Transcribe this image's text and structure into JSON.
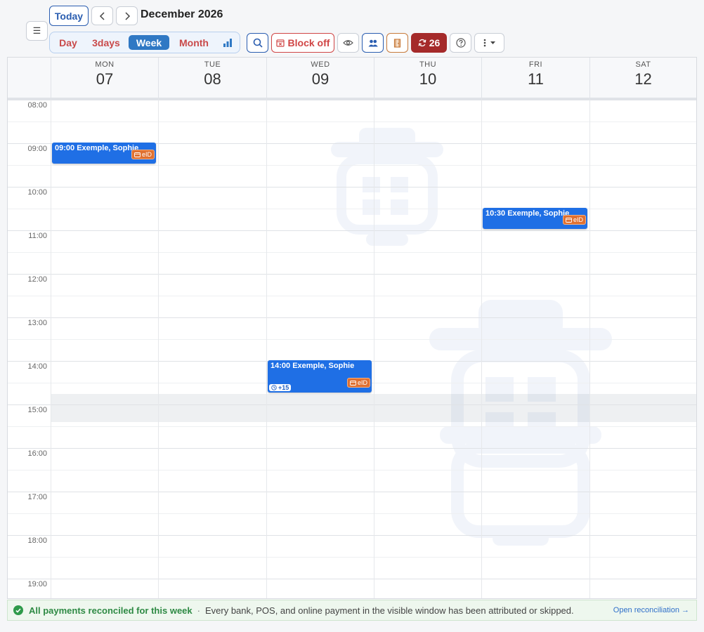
{
  "toolbar": {
    "today_label": "Today",
    "month_title": "December 2026",
    "views": {
      "day": "Day",
      "threedays": "3days",
      "week": "Week",
      "month": "Month"
    },
    "active_view": "Week",
    "block_off_label": "Block off",
    "sync_count": "26"
  },
  "days": [
    {
      "name": "MON",
      "num": "07"
    },
    {
      "name": "TUE",
      "num": "08"
    },
    {
      "name": "WED",
      "num": "09"
    },
    {
      "name": "THU",
      "num": "10"
    },
    {
      "name": "FRI",
      "num": "11"
    },
    {
      "name": "SAT",
      "num": "12"
    }
  ],
  "hours": [
    "08:00",
    "09:00",
    "10:00",
    "11:00",
    "12:00",
    "13:00",
    "14:00",
    "15:00",
    "16:00",
    "17:00",
    "18:00",
    "19:00"
  ],
  "events": [
    {
      "title": "09:00 Exemple, Sophie",
      "badge": "eID"
    },
    {
      "title": "10:30 Exemple, Sophie",
      "badge": "eID"
    },
    {
      "title": "14:00 Exemple, Sophie",
      "badge": "eID",
      "extra": "+15"
    }
  ],
  "footer": {
    "status": "All payments reconciled for this week",
    "separator": "·",
    "detail": "Every bank, POS, and online payment in the visible window has been attributed or skipped.",
    "link": "Open reconciliation →"
  },
  "colors": {
    "primary": "#2a5db0",
    "active_view": "#2f78c4",
    "danger": "#d04545",
    "sync": "#a52a2a",
    "event": "#1f6fe5",
    "eid_badge": "#e07030",
    "success": "#2e9a4a"
  }
}
